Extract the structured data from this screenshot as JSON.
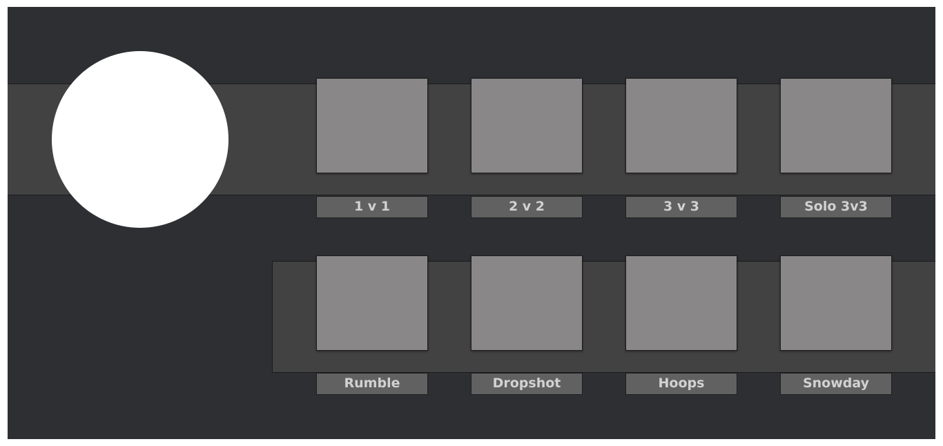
{
  "player": {
    "avatar_icon": "avatar-circle",
    "avatar_color": "#ffffff"
  },
  "colors": {
    "background": "#2d2f33",
    "band": "#424242",
    "tile": "#898787",
    "label_bg": "#616161",
    "label_text": "#d2d2d2"
  },
  "modes": {
    "row1": [
      {
        "label": "1 v 1"
      },
      {
        "label": "2 v 2"
      },
      {
        "label": "3 v 3"
      },
      {
        "label": "Solo 3v3"
      }
    ],
    "row2": [
      {
        "label": "Rumble"
      },
      {
        "label": "Dropshot"
      },
      {
        "label": "Hoops"
      },
      {
        "label": "Snowday"
      }
    ]
  }
}
